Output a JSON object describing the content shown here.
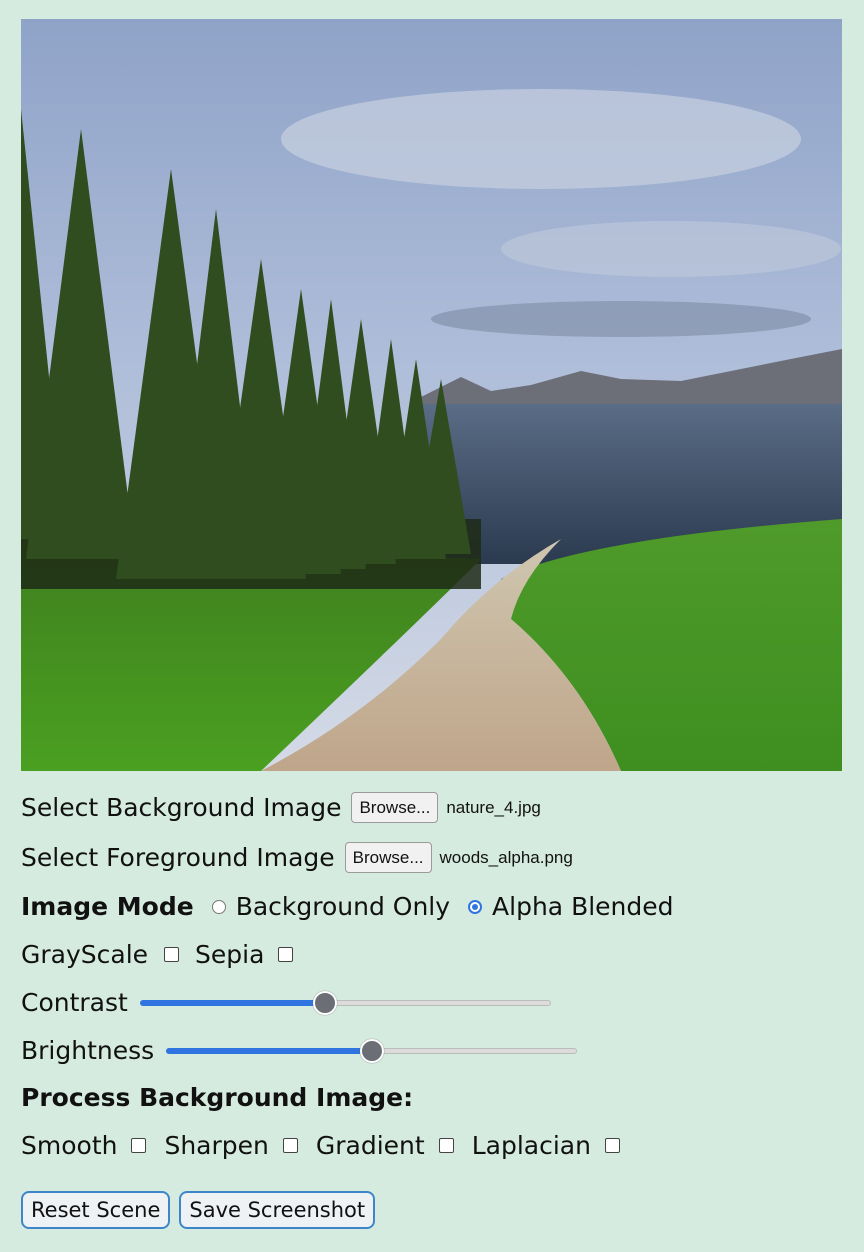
{
  "scene": {
    "image_alt": "Dirt path between pine trees and green grass leading to a lake under a cloudy sky"
  },
  "background": {
    "label": "Select Background Image",
    "browse_label": "Browse...",
    "file_name": "nature_4.jpg"
  },
  "foreground": {
    "label": "Select Foreground Image",
    "browse_label": "Browse...",
    "file_name": "woods_alpha.png"
  },
  "image_mode": {
    "label": "Image Mode",
    "options": [
      {
        "label": "Background Only",
        "selected": false
      },
      {
        "label": "Alpha Blended",
        "selected": true
      }
    ]
  },
  "filters": {
    "grayscale_label": "GrayScale",
    "sepia_label": "Sepia"
  },
  "contrast": {
    "label": "Contrast",
    "value_fraction": 0.45
  },
  "brightness": {
    "label": "Brightness",
    "value_fraction": 0.5
  },
  "process": {
    "heading": "Process Background Image:",
    "options": [
      "Smooth",
      "Sharpen",
      "Gradient",
      "Laplacian"
    ]
  },
  "buttons": {
    "reset_label": "Reset Scene",
    "save_label": "Save Screenshot"
  },
  "colors": {
    "accent": "#2f74e0",
    "page_background": "#d6ebe0",
    "button_border": "#3d87c9"
  }
}
